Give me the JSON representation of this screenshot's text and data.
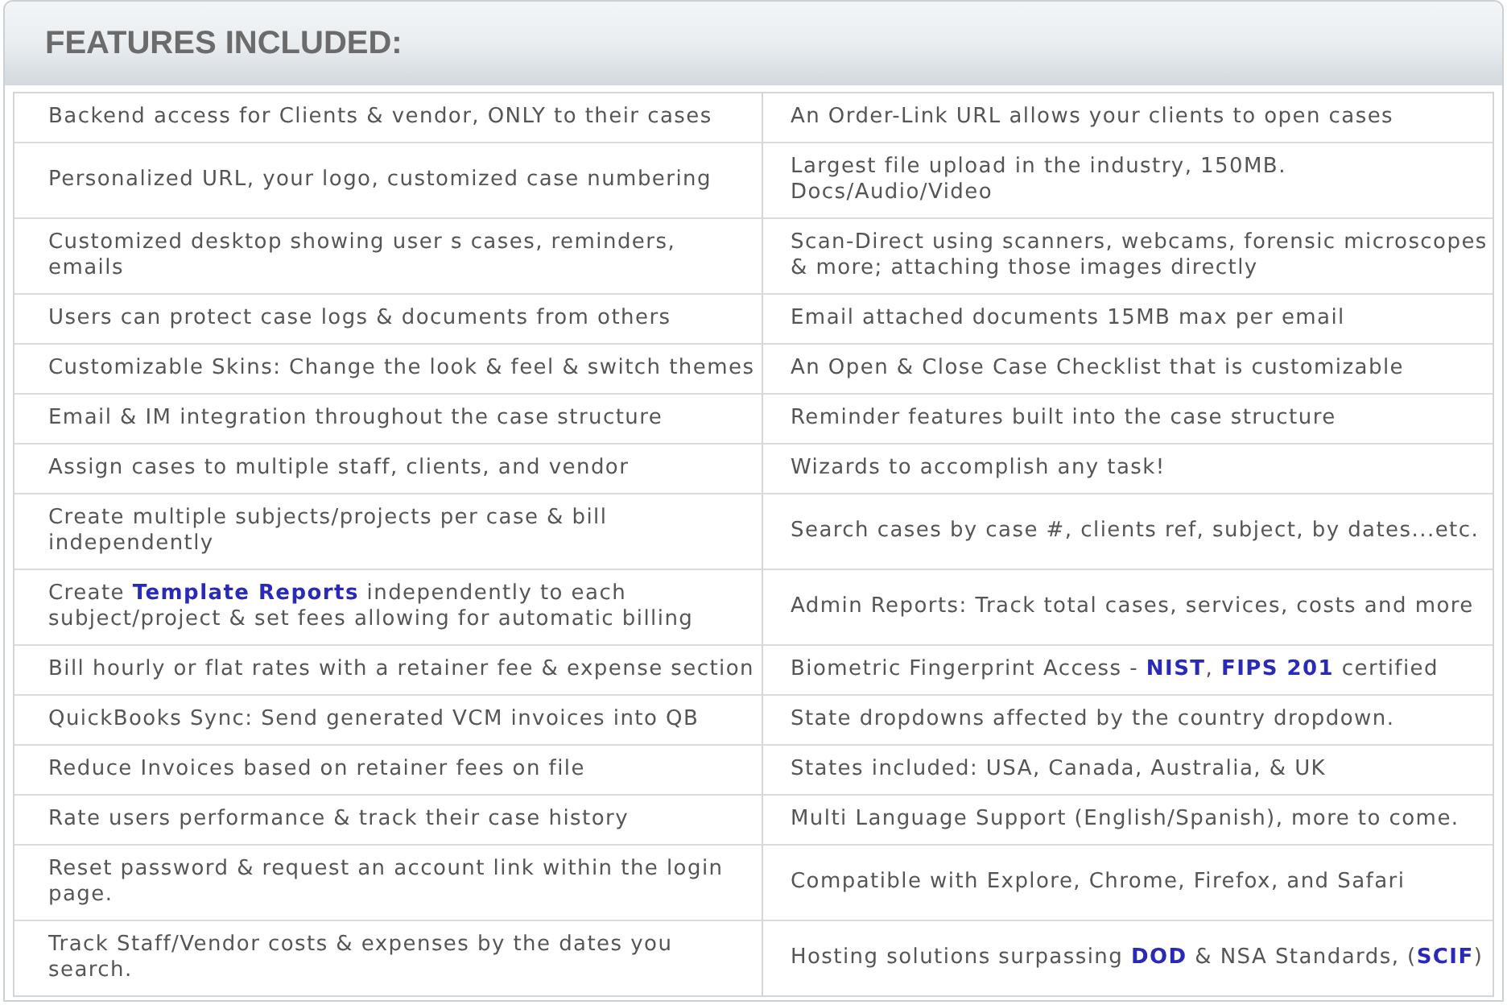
{
  "header": {
    "title": "FEATURES INCLUDED:"
  },
  "rows": [
    {
      "left": "Backend access for Clients & vendor, ONLY to their cases",
      "right": "An Order-Link URL allows your clients to open cases"
    },
    {
      "left": "Personalized URL, your logo, customized case numbering",
      "right": "Largest file upload in the industry, 150MB. Docs/Audio/Video"
    },
    {
      "left": "Customized desktop showing user s cases, reminders, emails",
      "right": "Scan-Direct using scanners, webcams, forensic microscopes & more; attaching those images directly"
    },
    {
      "left": "Users can protect case logs & documents from others",
      "right": "Email attached documents 15MB max per email"
    },
    {
      "left": "Customizable Skins: Change the look & feel & switch themes",
      "right": "An Open & Close Case Checklist that is customizable"
    },
    {
      "left": "Email & IM integration throughout the case structure",
      "right": "Reminder features built into the case structure"
    },
    {
      "left": "Assign cases to multiple staff, clients, and vendor",
      "right": "Wizards to accomplish any task!"
    },
    {
      "left": "Create multiple subjects/projects per case & bill independently",
      "right": "Search cases by case #, clients ref, subject, by dates...etc."
    },
    {
      "left": "Create **Template Reports** independently to each subject/project & set fees allowing for automatic billing",
      "right": "Admin Reports: Track total cases, services, costs and more"
    },
    {
      "left": "Bill hourly or flat rates with a retainer fee & expense section",
      "right": "Biometric Fingerprint Access - **NIST**, **FIPS 201** certified"
    },
    {
      "left": "QuickBooks Sync: Send generated VCM invoices into QB",
      "right": "State dropdowns affected by the country dropdown."
    },
    {
      "left": "Reduce Invoices based on retainer fees on file",
      "right": "States included: USA, Canada, Australia, & UK"
    },
    {
      "left": "Rate users performance & track their case history",
      "right": "Multi Language Support (English/Spanish), more to come."
    },
    {
      "left": "Reset password & request an account link within the login page.",
      "right": "Compatible with Explore, Chrome, Firefox, and Safari"
    },
    {
      "left": "Track Staff/Vendor costs & expenses by the dates you search.",
      "right": "Hosting solutions surpassing **DOD** & NSA Standards, (**SCIF**)"
    }
  ]
}
